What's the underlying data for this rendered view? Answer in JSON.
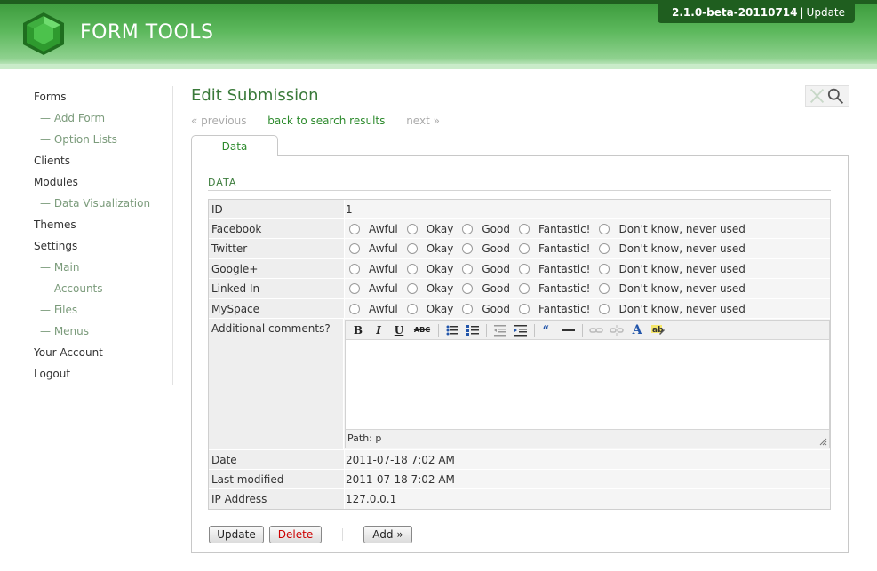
{
  "header": {
    "brand": "FORM TOOLS",
    "version": "2.1.0-beta-20110714",
    "separator": "|",
    "update_link": "Update",
    "accent": "#3e9c3e",
    "dark": "#1f5e1f"
  },
  "sidebar": {
    "items": [
      {
        "label": "Forms"
      },
      {
        "label": "— Add Form"
      },
      {
        "label": "— Option Lists"
      },
      {
        "label": "Clients"
      },
      {
        "label": "Modules"
      },
      {
        "label": "— Data Visualization"
      },
      {
        "label": "Themes"
      },
      {
        "label": "Settings"
      },
      {
        "label": "— Main"
      },
      {
        "label": "— Accounts"
      },
      {
        "label": "— Files"
      },
      {
        "label": "— Menus"
      },
      {
        "label": "Your Account"
      },
      {
        "label": "Logout"
      }
    ]
  },
  "main": {
    "title": "Edit Submission",
    "nav": {
      "previous": "« previous",
      "back": "back to search results",
      "next": "next »"
    },
    "tab": "Data",
    "section_title": "DATA",
    "rating_options": [
      "Awful",
      "Okay",
      "Good",
      "Fantastic!",
      "Don't know, never used"
    ],
    "fields": {
      "id_label": "ID",
      "id_value": "1",
      "facebook_label": "Facebook",
      "twitter_label": "Twitter",
      "googleplus_label": "Google+",
      "linkedin_label": "Linked In",
      "myspace_label": "MySpace",
      "comments_label": "Additional comments?",
      "path_text": "Path: p",
      "date_label": "Date",
      "date_value": "2011-07-18 7:02 AM",
      "modified_label": "Last modified",
      "modified_value": "2011-07-18 7:02 AM",
      "ip_label": "IP Address",
      "ip_value": "127.0.0.1"
    },
    "buttons": {
      "update": "Update",
      "delete": "Delete",
      "add": "Add »"
    }
  },
  "editor_toolbar": {
    "bold": "B",
    "italic": "I",
    "underline": "U",
    "strike": "ABC",
    "font_color": "A"
  }
}
